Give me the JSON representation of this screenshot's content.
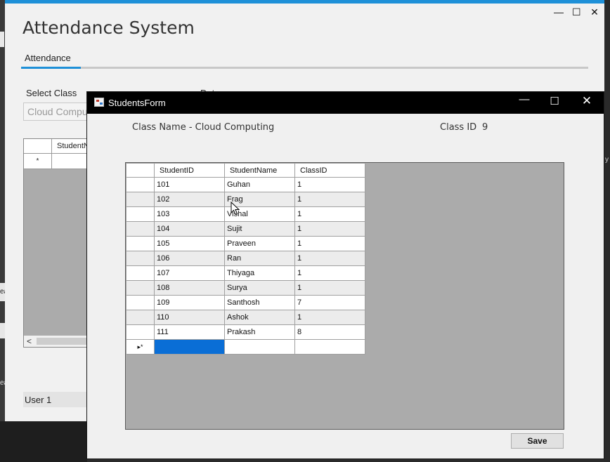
{
  "desktop": {
    "left_text_1": "ea",
    "left_text_2": "ea",
    "right_text": "y"
  },
  "main_window": {
    "controls": {
      "minimize": "—",
      "maximize": "☐",
      "close": "✕"
    },
    "title": "Attendance System",
    "tab_label": "Attendance",
    "select_class_label": "Select Class",
    "date_label": "Date",
    "class_combo_value": "Cloud Computing",
    "grid_header": "StudentName",
    "new_row_marker": "*",
    "scroll_left": "<",
    "status_text": "User  1"
  },
  "students_form": {
    "title": "StudentsForm",
    "controls": {
      "minimize": "—",
      "maximize": "☐",
      "close": "✕"
    },
    "class_name_label": "Class Name - Cloud Computing",
    "class_id_label": "Class ID",
    "class_id_value": "9",
    "columns": [
      "StudentID",
      "StudentName",
      "ClassID"
    ],
    "rows": [
      [
        "101",
        "Guhan",
        "1"
      ],
      [
        "102",
        "Frag",
        "1"
      ],
      [
        "103",
        "Vishal",
        "1"
      ],
      [
        "104",
        "Sujit",
        "1"
      ],
      [
        "105",
        "Praveen",
        "1"
      ],
      [
        "106",
        "Ran",
        "1"
      ],
      [
        "107",
        "Thiyaga",
        "1"
      ],
      [
        "108",
        "Surya",
        "1"
      ],
      [
        "109",
        "Santhosh",
        "7"
      ],
      [
        "110",
        "Ashok",
        "1"
      ],
      [
        "111",
        "Prakash",
        "8"
      ]
    ],
    "new_row_marker": "▸*",
    "save_label": "Save"
  },
  "colors": {
    "accent": "#1e90d8",
    "selection": "#0a6ed6",
    "grid_background": "#ababab",
    "dialog_titlebar": "#000000"
  }
}
